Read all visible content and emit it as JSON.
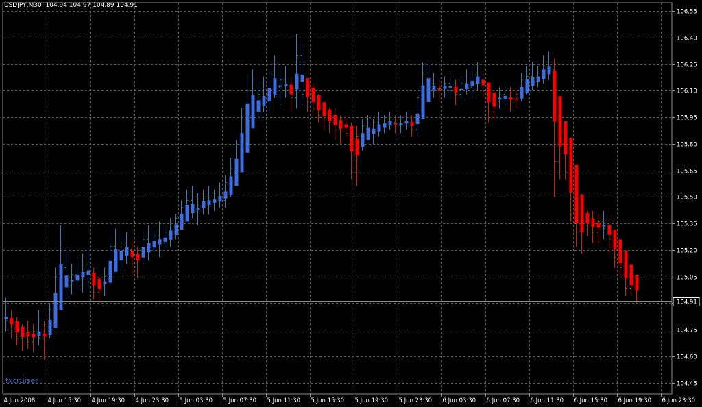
{
  "header": {
    "symbol": "USDJPY,M30",
    "ohlc": "104.94 104.97 104.89 104.91"
  },
  "watermark": "fxcruiser",
  "colors": {
    "background": "#000000",
    "grid": "#5a5a5a",
    "bar": "#00c000",
    "ha_bull": "#3c6ee0",
    "ha_bear": "#ff0000",
    "price_line": "#8c8c8c",
    "axis_text": "#ffffff"
  },
  "chart_data": {
    "type": "bar",
    "symbol": "USDJPY",
    "timeframe": "M30",
    "grid": true,
    "y_ticks": [
      "106.55",
      "106.40",
      "106.25",
      "106.10",
      "105.95",
      "105.80",
      "105.65",
      "105.50",
      "105.35",
      "105.20",
      "105.05",
      "104.90",
      "104.75",
      "104.60",
      "104.45"
    ],
    "ylim": [
      104.42,
      106.6
    ],
    "current_price": "104.91",
    "x_ticks": [
      "4 Jun 2008",
      "4 Jun 15:30",
      "4 Jun 19:30",
      "4 Jun 23:30",
      "5 Jun 03:30",
      "5 Jun 07:30",
      "5 Jun 11:30",
      "5 Jun 15:30",
      "5 Jun 19:30",
      "5 Jun 23:30",
      "6 Jun 03:30",
      "6 Jun 07:30",
      "6 Jun 11:30",
      "6 Jun 15:30",
      "6 Jun 19:30",
      "6 Jun 23:30"
    ],
    "bars_per_tick": 8,
    "ohlc_bars": [
      [
        104.82,
        104.93,
        104.74,
        104.8
      ],
      [
        104.8,
        104.86,
        104.7,
        104.76
      ],
      [
        104.76,
        104.82,
        104.66,
        104.7
      ],
      [
        104.7,
        104.78,
        104.63,
        104.72
      ],
      [
        104.72,
        104.8,
        104.64,
        104.68
      ],
      [
        104.68,
        104.78,
        104.62,
        104.74
      ],
      [
        104.74,
        104.86,
        104.66,
        104.7
      ],
      [
        104.7,
        104.8,
        104.58,
        104.76
      ],
      [
        104.76,
        104.9,
        104.7,
        104.86
      ],
      [
        104.86,
        105.1,
        104.82,
        105.05
      ],
      [
        105.05,
        105.34,
        104.98,
        105.1
      ],
      [
        105.1,
        105.2,
        104.92,
        105.0
      ],
      [
        105.0,
        105.12,
        104.95,
        105.06
      ],
      [
        105.06,
        105.16,
        104.98,
        105.04
      ],
      [
        105.04,
        105.18,
        104.96,
        105.12
      ],
      [
        105.12,
        105.22,
        104.98,
        105.02
      ],
      [
        105.02,
        105.1,
        104.92,
        104.96
      ],
      [
        104.96,
        105.05,
        104.9,
        105.0
      ],
      [
        105.0,
        105.1,
        104.94,
        105.05
      ],
      [
        105.05,
        105.28,
        105.0,
        105.22
      ],
      [
        105.22,
        105.32,
        105.1,
        105.18
      ],
      [
        105.18,
        105.28,
        105.08,
        105.24
      ],
      [
        105.24,
        105.3,
        105.12,
        105.2
      ],
      [
        105.2,
        105.26,
        105.06,
        105.12
      ],
      [
        105.12,
        105.22,
        105.04,
        105.18
      ],
      [
        105.18,
        105.3,
        105.12,
        105.26
      ],
      [
        105.26,
        105.34,
        105.14,
        105.22
      ],
      [
        105.22,
        105.32,
        105.18,
        105.28
      ],
      [
        105.28,
        105.36,
        105.16,
        105.24
      ],
      [
        105.24,
        105.34,
        105.2,
        105.3
      ],
      [
        105.3,
        105.38,
        105.22,
        105.34
      ],
      [
        105.34,
        105.4,
        105.26,
        105.38
      ],
      [
        105.38,
        105.48,
        105.32,
        105.44
      ],
      [
        105.44,
        105.54,
        105.36,
        105.48
      ],
      [
        105.48,
        105.56,
        105.38,
        105.42
      ],
      [
        105.42,
        105.52,
        105.34,
        105.46
      ],
      [
        105.46,
        105.54,
        105.4,
        105.5
      ],
      [
        105.5,
        105.56,
        105.4,
        105.46
      ],
      [
        105.46,
        105.54,
        105.42,
        105.52
      ],
      [
        105.52,
        105.58,
        105.44,
        105.48
      ],
      [
        105.48,
        105.62,
        105.44,
        105.58
      ],
      [
        105.58,
        105.72,
        105.5,
        105.66
      ],
      [
        105.66,
        105.82,
        105.6,
        105.78
      ],
      [
        105.78,
        106.0,
        105.72,
        105.94
      ],
      [
        105.94,
        106.18,
        105.88,
        106.1
      ],
      [
        106.1,
        106.22,
        105.96,
        106.02
      ],
      [
        106.02,
        106.14,
        105.94,
        106.08
      ],
      [
        106.08,
        106.18,
        105.98,
        106.04
      ],
      [
        106.04,
        106.24,
        105.98,
        106.2
      ],
      [
        106.2,
        106.3,
        106.06,
        106.12
      ],
      [
        106.12,
        106.22,
        106.02,
        106.16
      ],
      [
        106.16,
        106.24,
        106.06,
        106.1
      ],
      [
        106.1,
        106.18,
        105.98,
        106.06
      ],
      [
        106.06,
        106.42,
        106.0,
        106.3
      ],
      [
        106.3,
        106.36,
        106.02,
        106.08
      ],
      [
        106.08,
        106.16,
        105.98,
        106.04
      ],
      [
        106.04,
        106.14,
        105.96,
        106.0
      ],
      [
        106.0,
        106.08,
        105.92,
        105.96
      ],
      [
        105.96,
        106.04,
        105.88,
        105.94
      ],
      [
        105.94,
        106.0,
        105.86,
        105.92
      ],
      [
        105.92,
        106.0,
        105.82,
        105.88
      ],
      [
        105.88,
        105.96,
        105.8,
        105.9
      ],
      [
        105.9,
        105.96,
        105.84,
        105.86
      ],
      [
        105.86,
        105.92,
        105.6,
        105.64
      ],
      [
        105.64,
        105.9,
        105.56,
        105.84
      ],
      [
        105.84,
        105.94,
        105.76,
        105.9
      ],
      [
        105.9,
        105.96,
        105.82,
        105.88
      ],
      [
        105.88,
        105.94,
        105.8,
        105.92
      ],
      [
        105.92,
        105.98,
        105.84,
        105.9
      ],
      [
        105.9,
        105.96,
        105.86,
        105.94
      ],
      [
        105.94,
        105.98,
        105.88,
        105.92
      ],
      [
        105.92,
        105.96,
        105.86,
        105.9
      ],
      [
        105.9,
        105.96,
        105.86,
        105.94
      ],
      [
        105.94,
        105.98,
        105.88,
        105.92
      ],
      [
        105.92,
        105.96,
        105.84,
        105.88
      ],
      [
        105.88,
        106.1,
        105.84,
        106.06
      ],
      [
        106.06,
        106.26,
        106.0,
        106.2
      ],
      [
        106.2,
        106.26,
        106.08,
        106.14
      ],
      [
        106.14,
        106.2,
        106.06,
        106.1
      ],
      [
        106.1,
        106.16,
        106.04,
        106.12
      ],
      [
        106.12,
        106.18,
        106.06,
        106.14
      ],
      [
        106.14,
        106.2,
        106.06,
        106.1
      ],
      [
        106.1,
        106.16,
        106.02,
        106.08
      ],
      [
        106.08,
        106.18,
        106.04,
        106.14
      ],
      [
        106.14,
        106.22,
        106.08,
        106.12
      ],
      [
        106.12,
        106.24,
        106.06,
        106.2
      ],
      [
        106.2,
        106.26,
        106.1,
        106.16
      ],
      [
        106.16,
        106.2,
        106.06,
        106.1
      ],
      [
        106.1,
        106.14,
        105.92,
        105.98
      ],
      [
        105.98,
        106.08,
        105.94,
        106.04
      ],
      [
        106.04,
        106.12,
        106.0,
        106.08
      ],
      [
        106.08,
        106.12,
        106.02,
        106.06
      ],
      [
        106.06,
        106.12,
        105.98,
        106.04
      ],
      [
        106.04,
        106.1,
        106.0,
        106.08
      ],
      [
        106.08,
        106.2,
        106.04,
        106.16
      ],
      [
        106.16,
        106.24,
        106.08,
        106.18
      ],
      [
        106.18,
        106.26,
        106.1,
        106.16
      ],
      [
        106.16,
        106.24,
        106.12,
        106.2
      ],
      [
        106.2,
        106.3,
        106.14,
        106.24
      ],
      [
        106.24,
        106.32,
        106.16,
        106.22
      ],
      [
        106.22,
        106.28,
        105.5,
        105.7
      ],
      [
        105.7,
        106.02,
        105.6,
        105.82
      ],
      [
        105.82,
        105.9,
        105.6,
        105.64
      ],
      [
        105.64,
        105.7,
        105.36,
        105.4
      ],
      [
        105.4,
        105.48,
        105.22,
        105.3
      ],
      [
        105.3,
        105.38,
        105.18,
        105.34
      ],
      [
        105.34,
        105.42,
        105.28,
        105.36
      ],
      [
        105.36,
        105.42,
        105.24,
        105.3
      ],
      [
        105.3,
        105.4,
        105.24,
        105.36
      ],
      [
        105.36,
        105.42,
        105.26,
        105.32
      ],
      [
        105.32,
        105.38,
        105.18,
        105.26
      ],
      [
        105.26,
        105.3,
        105.1,
        105.16
      ],
      [
        105.16,
        105.2,
        105.04,
        105.1
      ],
      [
        105.1,
        105.14,
        104.94,
        104.98
      ],
      [
        104.98,
        105.06,
        104.94,
        105.02
      ],
      [
        105.02,
        105.06,
        104.9,
        104.91
      ]
    ]
  }
}
